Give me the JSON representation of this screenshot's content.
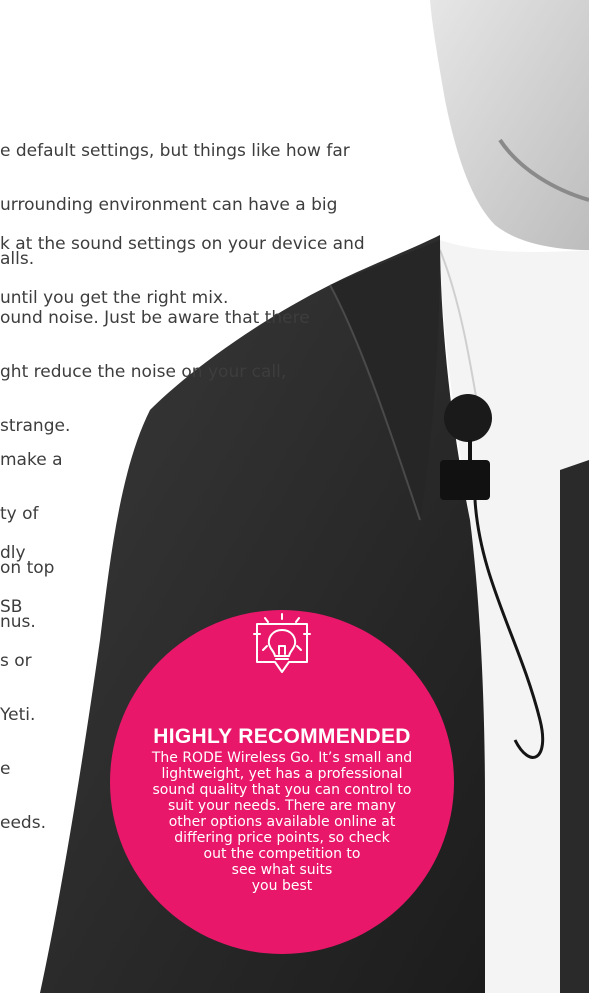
{
  "body_text": {
    "p1": [
      "e default settings, but things like how far",
      "urrounding environment can have a big",
      "alls."
    ],
    "p2": [
      "k at the sound settings on your device and",
      "until you get the right mix."
    ],
    "p3": [
      "ound noise. Just be aware that there",
      "ght reduce the noise on your call,",
      "strange."
    ],
    "p4": [
      "make a",
      "ty of",
      "on top",
      "nus."
    ],
    "p5": [
      "dly",
      "SB",
      "s or",
      "Yeti.",
      "e",
      "eeds."
    ]
  },
  "callout": {
    "icon": "lightbulb-icon",
    "title": "HIGHLY RECOMMENDED",
    "lines": [
      "The RODE Wireless Go. It’s small and",
      "lightweight, yet has a professional",
      "sound  quality that you can control to",
      "suit your needs. There are many",
      "other options available online at",
      "differing price points, so check",
      "out the competition to",
      "see what suits",
      "you best"
    ],
    "color": "#e9176a"
  },
  "colors": {
    "jacket": "#2b2b2b",
    "shirt": "#f2f2f2",
    "skin": "#dcdcdc",
    "text": "#3d3d3d"
  }
}
